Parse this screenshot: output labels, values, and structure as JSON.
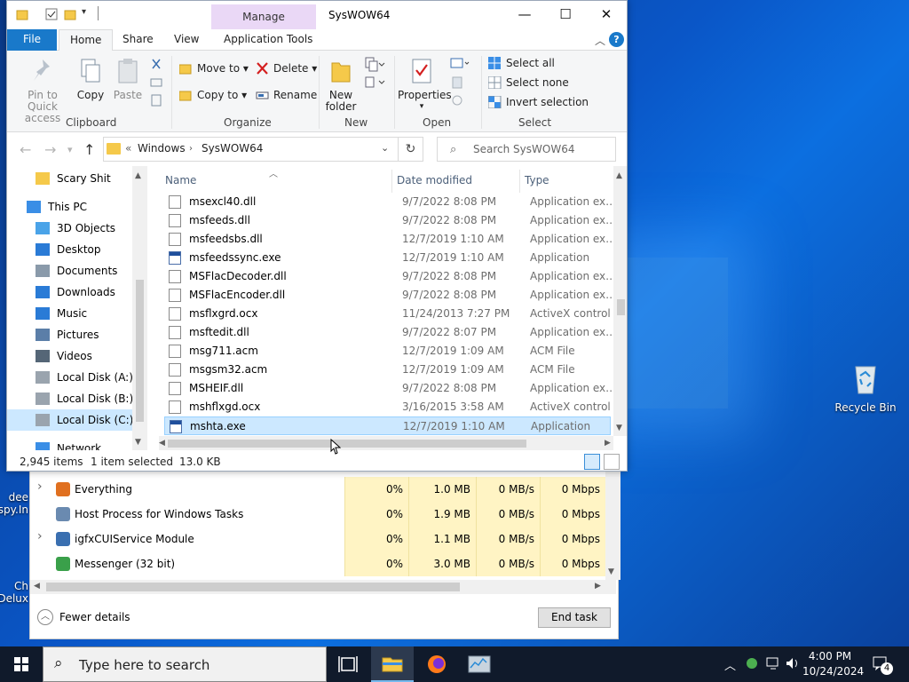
{
  "desktop": {
    "recycle_bin_label": "Recycle Bin",
    "left_icon_1": "dee",
    "left_icon_1b": "spy.In",
    "left_icon_2": "Ch",
    "left_icon_2b": "Delux"
  },
  "explorer": {
    "title": "SysWOW64",
    "manage_tab": "Manage",
    "tabs": [
      "File",
      "Home",
      "Share",
      "View",
      "Application Tools"
    ],
    "clipboard": {
      "pin": "Pin to Quick access",
      "copy": "Copy",
      "paste": "Paste",
      "label": "Clipboard"
    },
    "organize": {
      "move_to": "Move to",
      "copy_to": "Copy to",
      "delete": "Delete",
      "rename": "Rename",
      "label": "Organize"
    },
    "new": {
      "new_folder": "New folder",
      "label": "New"
    },
    "open": {
      "properties": "Properties",
      "label": "Open"
    },
    "select": {
      "select_all": "Select all",
      "select_none": "Select none",
      "invert": "Invert selection",
      "label": "Select"
    },
    "address": {
      "prefix": "«",
      "path": [
        "Windows",
        "SysWOW64"
      ]
    },
    "search_placeholder": "Search SysWOW64",
    "nav": [
      {
        "label": "Scary Shit",
        "icon": "folder-icon"
      },
      {
        "label": "This PC",
        "icon": "computer-icon"
      },
      {
        "label": "3D Objects",
        "icon": "3d-objects-icon"
      },
      {
        "label": "Desktop",
        "icon": "desktop-icon"
      },
      {
        "label": "Documents",
        "icon": "documents-icon"
      },
      {
        "label": "Downloads",
        "icon": "downloads-icon"
      },
      {
        "label": "Music",
        "icon": "music-icon"
      },
      {
        "label": "Pictures",
        "icon": "pictures-icon"
      },
      {
        "label": "Videos",
        "icon": "videos-icon"
      },
      {
        "label": "Local Disk (A:)",
        "icon": "drive-icon"
      },
      {
        "label": "Local Disk (B:)",
        "icon": "drive-icon"
      },
      {
        "label": "Local Disk (C:)",
        "icon": "drive-icon"
      },
      {
        "label": "Network",
        "icon": "network-icon"
      }
    ],
    "columns": {
      "name": "Name",
      "date": "Date modified",
      "type": "Type"
    },
    "files": [
      {
        "name": "msexcl40.dll",
        "date": "9/7/2022 8:08 PM",
        "type": "Application exten...",
        "kind": "dll"
      },
      {
        "name": "msfeeds.dll",
        "date": "9/7/2022 8:08 PM",
        "type": "Application exten...",
        "kind": "dll"
      },
      {
        "name": "msfeedsbs.dll",
        "date": "12/7/2019 1:10 AM",
        "type": "Application exten...",
        "kind": "dll"
      },
      {
        "name": "msfeedssync.exe",
        "date": "12/7/2019 1:10 AM",
        "type": "Application",
        "kind": "exe"
      },
      {
        "name": "MSFlacDecoder.dll",
        "date": "9/7/2022 8:08 PM",
        "type": "Application exten...",
        "kind": "dll"
      },
      {
        "name": "MSFlacEncoder.dll",
        "date": "9/7/2022 8:08 PM",
        "type": "Application exten...",
        "kind": "dll"
      },
      {
        "name": "msflxgrd.ocx",
        "date": "11/24/2013 7:27 PM",
        "type": "ActiveX control",
        "kind": "dll"
      },
      {
        "name": "msftedit.dll",
        "date": "9/7/2022 8:07 PM",
        "type": "Application exten...",
        "kind": "dll"
      },
      {
        "name": "msg711.acm",
        "date": "12/7/2019 1:09 AM",
        "type": "ACM File",
        "kind": "file"
      },
      {
        "name": "msgsm32.acm",
        "date": "12/7/2019 1:09 AM",
        "type": "ACM File",
        "kind": "file"
      },
      {
        "name": "MSHEIF.dll",
        "date": "9/7/2022 8:08 PM",
        "type": "Application exten...",
        "kind": "dll"
      },
      {
        "name": "mshflxgd.ocx",
        "date": "3/16/2015 3:58 AM",
        "type": "ActiveX control",
        "kind": "dll"
      },
      {
        "name": "mshta.exe",
        "date": "12/7/2019 1:10 AM",
        "type": "Application",
        "kind": "exe",
        "selected": true
      }
    ],
    "status": {
      "items": "2,945 items",
      "selected": "1 item selected",
      "size": "13.0 KB"
    }
  },
  "taskmgr": {
    "rows": [
      {
        "name": "Everything",
        "cpu": "0%",
        "mem": "1.0 MB",
        "disk": "0 MB/s",
        "net": "0 Mbps",
        "expand": true
      },
      {
        "name": "Host Process for Windows Tasks",
        "cpu": "0%",
        "mem": "1.9 MB",
        "disk": "0 MB/s",
        "net": "0 Mbps",
        "expand": false
      },
      {
        "name": "igfxCUIService Module",
        "cpu": "0%",
        "mem": "1.1 MB",
        "disk": "0 MB/s",
        "net": "0 Mbps",
        "expand": true
      },
      {
        "name": "Messenger (32 bit)",
        "cpu": "0%",
        "mem": "3.0 MB",
        "disk": "0 MB/s",
        "net": "0 Mbps",
        "expand": false
      }
    ],
    "fewer_details": "Fewer details",
    "end_task": "End task"
  },
  "taskbar": {
    "search_placeholder": "Type here to search",
    "time": "4:00 PM",
    "date": "10/24/2024",
    "notifications": "4"
  },
  "colors": {
    "accent": "#1979ca",
    "selection": "#cce8ff",
    "manage_tab": "#ead8f6"
  }
}
